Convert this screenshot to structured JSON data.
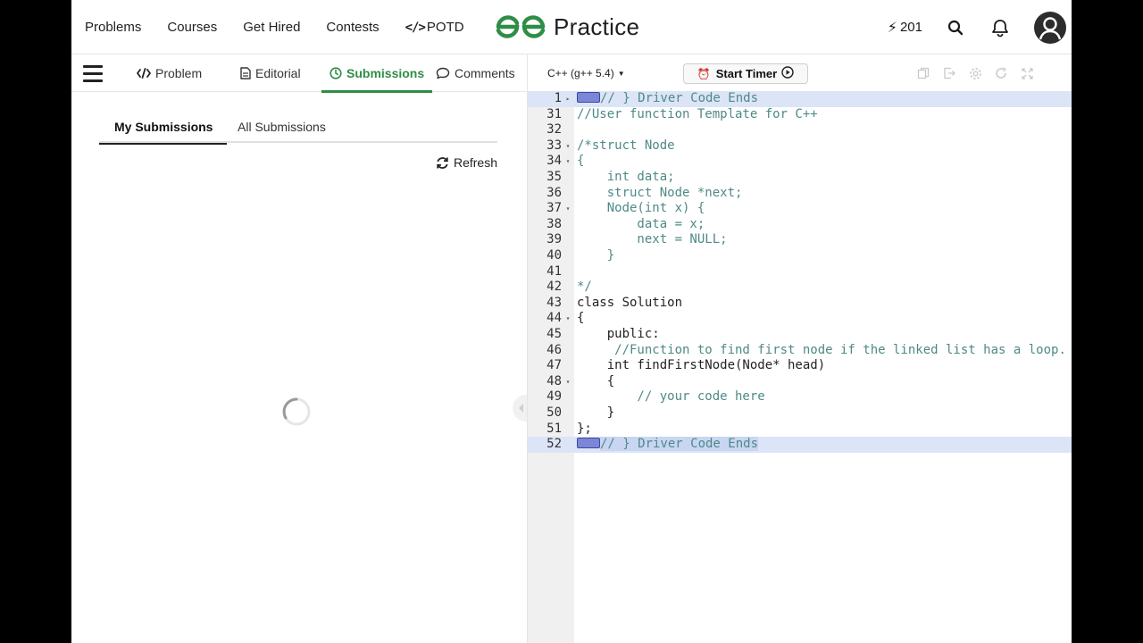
{
  "nav": {
    "links": [
      "Problems",
      "Courses",
      "Get Hired",
      "Contests",
      "POTD"
    ],
    "potd_icon": "</>",
    "logo_text": "Practice",
    "streak_count": "201",
    "icons": [
      "lightning-icon",
      "search-icon",
      "bell-icon",
      "avatar-icon"
    ]
  },
  "tabs": [
    {
      "label": "Problem",
      "icon": "code-icon"
    },
    {
      "label": "Editorial",
      "icon": "document-icon"
    },
    {
      "label": "Submissions",
      "icon": "clock-icon"
    },
    {
      "label": "Comments",
      "icon": "chat-icon"
    }
  ],
  "subtabs": [
    "My Submissions",
    "All Submissions"
  ],
  "refresh_label": "Refresh",
  "editor": {
    "language": "C++ (g++ 5.4)",
    "timer_label": "Start Timer",
    "lines": [
      {
        "n": "1",
        "fold": "▸",
        "text": "// } Driver Code Ends",
        "style": "comment",
        "highlight": true,
        "foldbox": true
      },
      {
        "n": "31",
        "fold": "",
        "text": "//User function Template for C++",
        "style": "comment"
      },
      {
        "n": "32",
        "fold": "",
        "text": "",
        "style": "plain"
      },
      {
        "n": "33",
        "fold": "▾",
        "text": "/*struct Node",
        "style": "comment"
      },
      {
        "n": "34",
        "fold": "▾",
        "text": "{",
        "style": "comment"
      },
      {
        "n": "35",
        "fold": "",
        "text": "    int data;",
        "style": "comment"
      },
      {
        "n": "36",
        "fold": "",
        "text": "    struct Node *next;",
        "style": "comment"
      },
      {
        "n": "37",
        "fold": "▾",
        "text": "    Node(int x) {",
        "style": "comment"
      },
      {
        "n": "38",
        "fold": "",
        "text": "        data = x;",
        "style": "comment"
      },
      {
        "n": "39",
        "fold": "",
        "text": "        next = NULL;",
        "style": "comment"
      },
      {
        "n": "40",
        "fold": "",
        "text": "    }",
        "style": "comment"
      },
      {
        "n": "41",
        "fold": "",
        "text": "",
        "style": "comment"
      },
      {
        "n": "42",
        "fold": "",
        "text": "*/",
        "style": "comment"
      },
      {
        "n": "43",
        "fold": "",
        "text": "class Solution",
        "style": "plain"
      },
      {
        "n": "44",
        "fold": "▾",
        "text": "{",
        "style": "plain"
      },
      {
        "n": "45",
        "fold": "",
        "text": "    public:",
        "style": "plain"
      },
      {
        "n": "46",
        "fold": "",
        "text": "     //Function to find first node if the linked list has a loop.",
        "style": "comment"
      },
      {
        "n": "47",
        "fold": "",
        "text": "    int findFirstNode(Node* head)",
        "style": "plain"
      },
      {
        "n": "48",
        "fold": "▾",
        "text": "    {",
        "style": "plain"
      },
      {
        "n": "49",
        "fold": "",
        "text": "        // your code here",
        "style": "comment"
      },
      {
        "n": "50",
        "fold": "",
        "text": "    }",
        "style": "plain"
      },
      {
        "n": "51",
        "fold": "",
        "text": "};",
        "style": "plain"
      },
      {
        "n": "52",
        "fold": "",
        "text": "// } Driver Code Ends",
        "style": "comment",
        "highlight": true,
        "foldbox": true,
        "selected": true
      }
    ]
  }
}
